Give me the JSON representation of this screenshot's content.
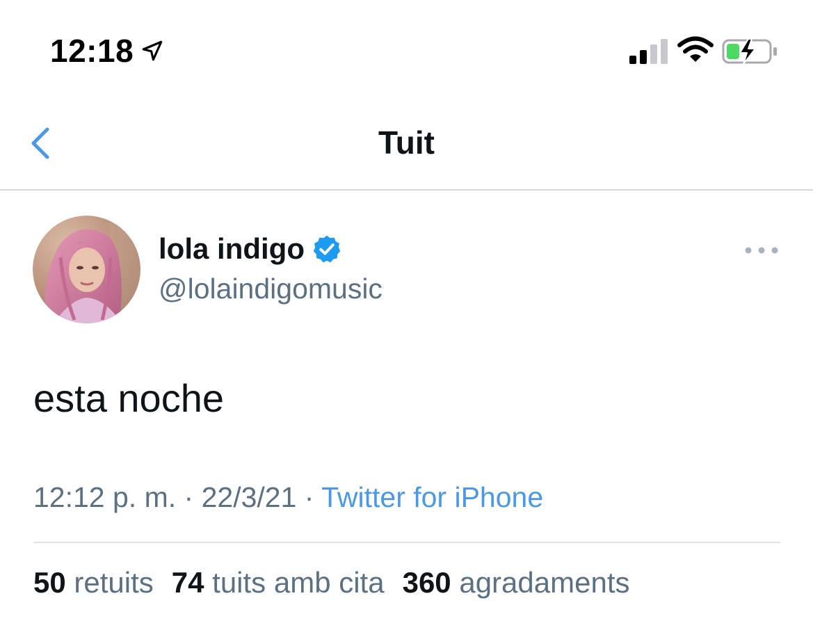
{
  "status_bar": {
    "time": "12:18",
    "location_icon": "location-arrow-icon",
    "signal_icon": "cellular-signal-icon",
    "wifi_icon": "wifi-icon",
    "battery_icon": "battery-charging-icon"
  },
  "header": {
    "back_icon": "chevron-left-icon",
    "title": "Tuit"
  },
  "tweet": {
    "author_name": "lola indigo",
    "verified_icon": "verified-badge-icon",
    "handle": "@lolaindigomusic",
    "more_icon": "more-horizontal-icon",
    "text": "esta noche",
    "time": "12:12 p. m.",
    "separator": "·",
    "date": "22/3/21",
    "source": "Twitter for iPhone",
    "stats": {
      "retweets_count": "50",
      "retweets_label": "retuits",
      "quotes_count": "74",
      "quotes_label": "tuits amb cita",
      "likes_count": "360",
      "likes_label": "agradaments"
    }
  },
  "colors": {
    "accent": "#4a99e9",
    "verified": "#1d9bf0",
    "secondary_text": "#5b7083",
    "primary_text": "#0f1419",
    "battery_charge": "#4cd964"
  }
}
